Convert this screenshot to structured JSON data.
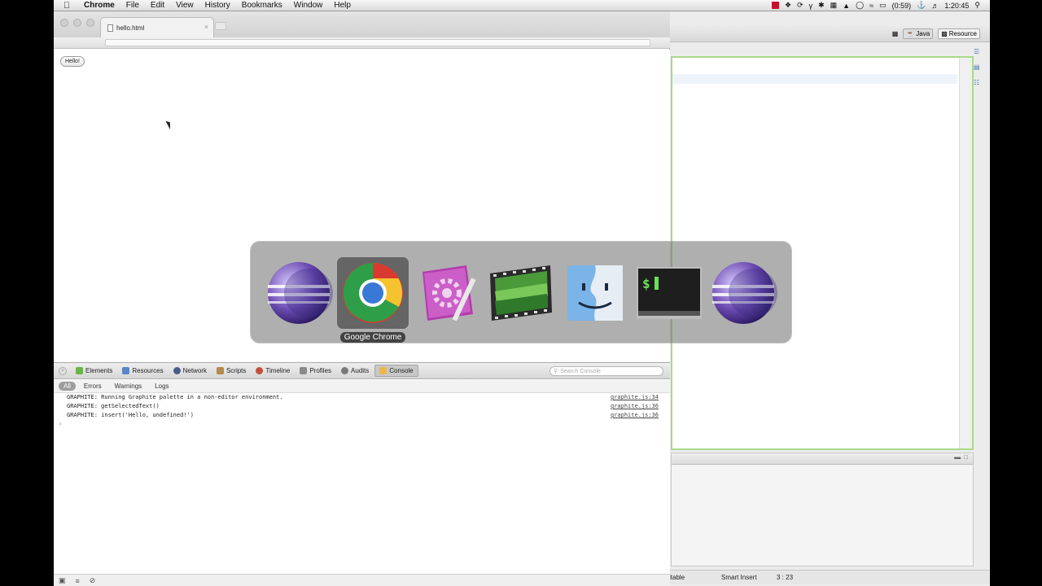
{
  "menubar": {
    "app_name": "Chrome",
    "items": [
      "File",
      "Edit",
      "View",
      "History",
      "Bookmarks",
      "Window",
      "Help"
    ],
    "battery": "(0:59)",
    "clock": "1:20:45"
  },
  "chrome": {
    "tab_title": "hello.html",
    "page_button": "Hello!"
  },
  "devtools": {
    "tabs": [
      "Elements",
      "Resources",
      "Network",
      "Scripts",
      "Timeline",
      "Profiles",
      "Audits",
      "Console"
    ],
    "search_placeholder": "Search Console",
    "filters": [
      "All",
      "Errors",
      "Warnings",
      "Logs"
    ],
    "console_rows": [
      {
        "message": "GRAPHITE: Running Graphite palette in a non-editor environment.",
        "source": "graphite.js:34"
      },
      {
        "message": "GRAPHITE: getSelectedText()",
        "source": "graphite.js:36"
      },
      {
        "message": "GRAPHITE: insert('Hello, undefined!')",
        "source": "graphite.js:36"
      }
    ]
  },
  "eclipse": {
    "perspectives": [
      "Java",
      "Resource"
    ],
    "status_writable": "itable",
    "status_insert": "Smart Insert",
    "status_position": "3 : 23"
  },
  "switcher": {
    "selected_label": "Google Chrome",
    "apps": [
      "eclipse-icon",
      "google-chrome-icon",
      "automator-icon",
      "imovie-icon",
      "finder-icon",
      "terminal-icon",
      "eclipse-icon"
    ]
  },
  "colors": {
    "editor_border": "#a8d98a",
    "accent_red": "#c8102e"
  }
}
